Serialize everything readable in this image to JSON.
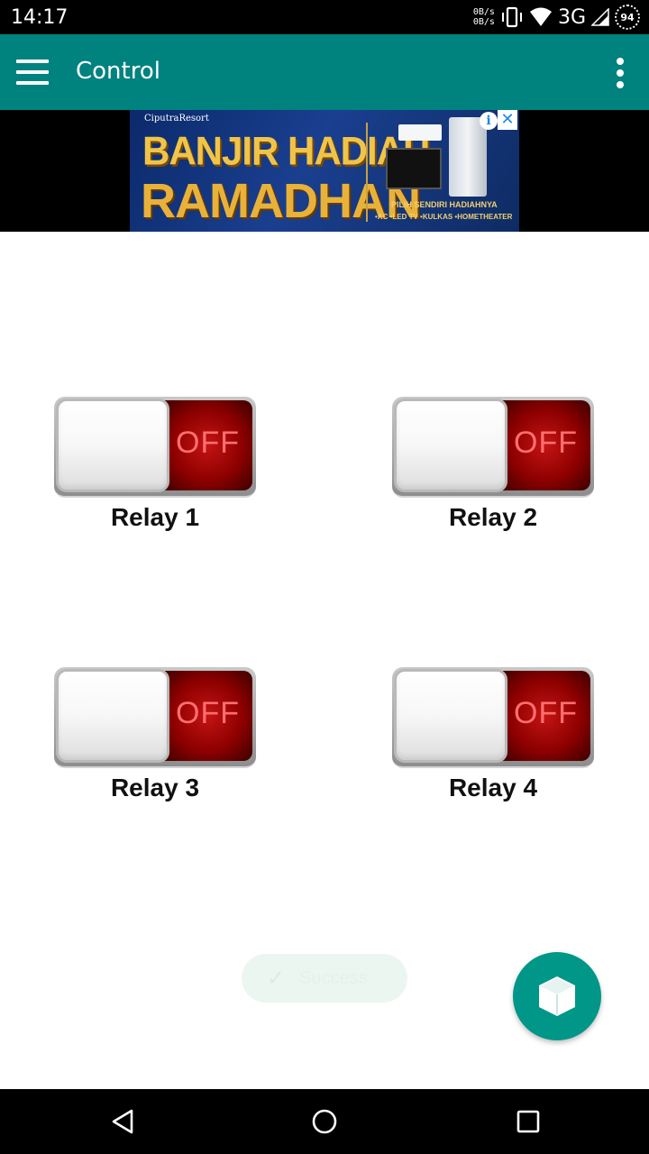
{
  "status_bar": {
    "time": "14:17",
    "net_up": "0B/s",
    "net_down": "0B/s",
    "network_type": "3G",
    "battery": "94",
    "icons": [
      "vibrate-icon",
      "wifi-icon",
      "signal-icon",
      "battery-icon"
    ]
  },
  "app_bar": {
    "title": "Control",
    "background": "#00827f"
  },
  "ad": {
    "brand": "CiputraResort",
    "headline_1": "BANJIR HADIAH",
    "headline_2": "RAMADHAN",
    "subtitle": "PILIH SENDIRI HADIAHNYA",
    "items": "•AC  •LED TV  •KULKAS  •HOMETHEATER",
    "info_label": "i",
    "close_label": "✕"
  },
  "relays": [
    {
      "label": "Relay 1",
      "state": "OFF"
    },
    {
      "label": "Relay 2",
      "state": "OFF"
    },
    {
      "label": "Relay 3",
      "state": "OFF"
    },
    {
      "label": "Relay 4",
      "state": "OFF"
    }
  ],
  "toast": {
    "icon": "✓",
    "text": "Success"
  },
  "fab": {
    "icon": "cube-icon",
    "color": "#009688"
  },
  "nav_bar": {
    "icons": [
      "back-icon",
      "home-icon",
      "recent-apps-icon"
    ]
  }
}
